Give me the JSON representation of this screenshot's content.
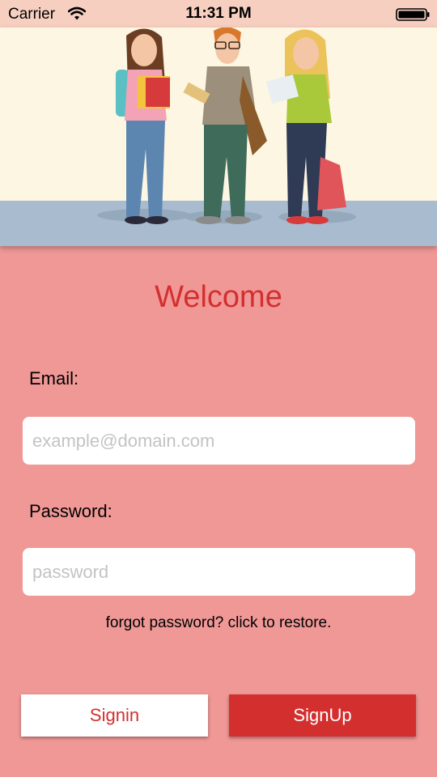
{
  "status_bar": {
    "carrier": "Carrier",
    "time": "11:31 PM"
  },
  "hero": {
    "illustration": "three students standing with books and bags"
  },
  "title": "Welcome",
  "form": {
    "email_label": "Email:",
    "email_placeholder": "example@domain.com",
    "email_value": "",
    "password_label": "Password:",
    "password_placeholder": "password",
    "password_value": "",
    "forgot_link": "forgot password? click to restore."
  },
  "buttons": {
    "signin": "Signin",
    "signup": "SignUp"
  },
  "colors": {
    "background": "#ef9896",
    "accent": "#d32f2f",
    "status_bar": "#f6cfc0",
    "hero_background": "#fcf6e2",
    "hero_floor": "#a9bccf"
  }
}
